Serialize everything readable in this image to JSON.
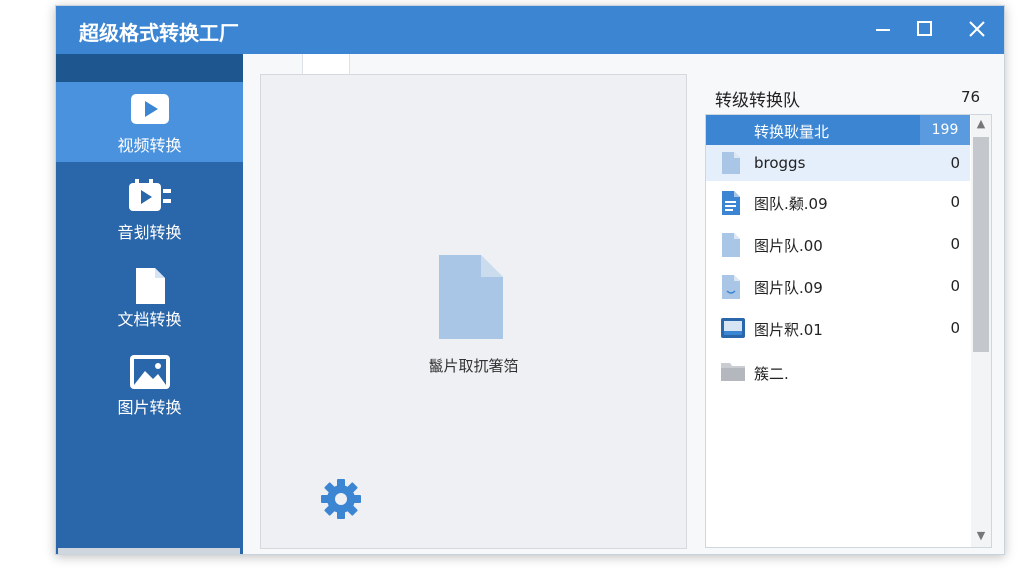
{
  "window": {
    "title": "超级格式转换工厂"
  },
  "sidebar": {
    "items": [
      {
        "label": "视频转换",
        "icon": "video-play-icon",
        "active": true
      },
      {
        "label": "音刬转换",
        "icon": "audio-icon",
        "active": false
      },
      {
        "label": "文档转换",
        "icon": "document-icon",
        "active": false
      },
      {
        "label": "图片转换",
        "icon": "image-icon",
        "active": false
      }
    ]
  },
  "drop_area": {
    "label": "鬣片取扤箸箔"
  },
  "queue": {
    "title": "转级转换队",
    "count": "76",
    "header": {
      "label": "转换耿量北",
      "count": "199"
    },
    "rows": [
      {
        "name": "broggs",
        "value": "0",
        "icon": "file-icon"
      },
      {
        "name": "图队.颡.09",
        "value": "0",
        "icon": "document-icon"
      },
      {
        "name": "图片队.00",
        "value": "0",
        "icon": "file-icon"
      },
      {
        "name": "图片队.09",
        "value": "0",
        "icon": "audio-file-icon"
      },
      {
        "name": "图片釈.01",
        "value": "0",
        "icon": "image-file-icon"
      },
      {
        "name": "簇二.",
        "value": "",
        "icon": "folder-icon"
      }
    ]
  },
  "colors": {
    "accent": "#3b85d2",
    "sidebar": "#2a66aa",
    "sidebar_active": "#4a92de"
  }
}
